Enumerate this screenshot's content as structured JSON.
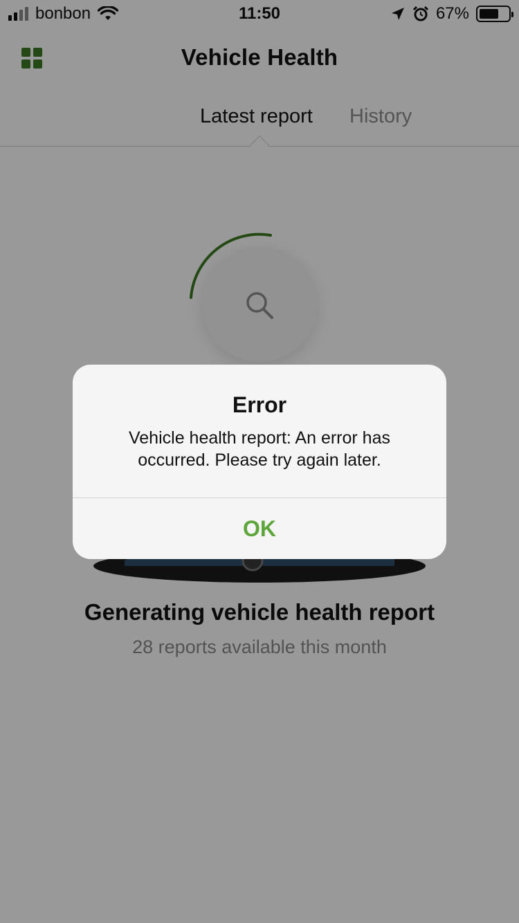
{
  "status_bar": {
    "carrier": "bonbon",
    "time": "11:50",
    "battery_percent": "67%",
    "battery_level": 0.67,
    "icons": [
      "signal-icon",
      "wifi-icon",
      "location-arrow-icon",
      "alarm-icon",
      "battery-icon"
    ]
  },
  "header": {
    "title": "Vehicle Health",
    "menu_icon": "grid-menu-icon"
  },
  "tabs": [
    {
      "label": "Latest report",
      "active": true
    },
    {
      "label": "History",
      "active": false
    }
  ],
  "main": {
    "progress_icon": "search-icon",
    "generating_title": "Generating vehicle health report",
    "reports_available": "28 reports available this month"
  },
  "alert": {
    "title": "Error",
    "message": "Vehicle health report: An error has occurred. Please try again later.",
    "ok_label": "OK"
  },
  "colors": {
    "accent_green": "#5ea63c",
    "menu_green": "#3d7a23",
    "spinner_green": "#3d7a23",
    "overlay": "rgba(0,0,0,0.4)"
  }
}
